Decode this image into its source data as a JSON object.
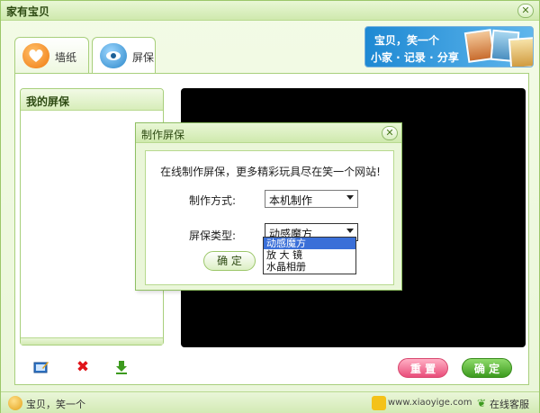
{
  "window": {
    "title": "家有宝贝",
    "close_glyph": "✕"
  },
  "tabs": [
    {
      "label": "墙纸",
      "icon": "heart-icon",
      "active": false
    },
    {
      "label": "屏保",
      "icon": "eye-icon",
      "active": true
    }
  ],
  "banner": {
    "line1": "宝贝，笑一个",
    "line2": "小家 · 记录 · 分享"
  },
  "saver_list": {
    "header": "我的屏保"
  },
  "toolbar": {
    "delete_glyph": "✖"
  },
  "buttons": {
    "reset_label": "重 置",
    "ok_label": "确 定"
  },
  "statusbar": {
    "slogan": "宝贝，笑一个",
    "url": "www.xiaoyige.com",
    "service": "在线客服"
  },
  "dialog": {
    "title": "制作屏保",
    "close_glyph": "✕",
    "intro": "在线制作屏保，更多精彩玩具尽在笑一个网站!",
    "method_label": "制作方式:",
    "method_value": "本机制作",
    "type_label": "屏保类型:",
    "type_value": "动感魔方",
    "ok_label": "确 定",
    "type_options": [
      "动感魔方",
      "放 大 镜",
      "水晶相册"
    ]
  },
  "colors": {
    "accent_green": "#3c9a1e",
    "reset_pink": "#e94d7a",
    "selection_blue": "#3a6fd8"
  }
}
